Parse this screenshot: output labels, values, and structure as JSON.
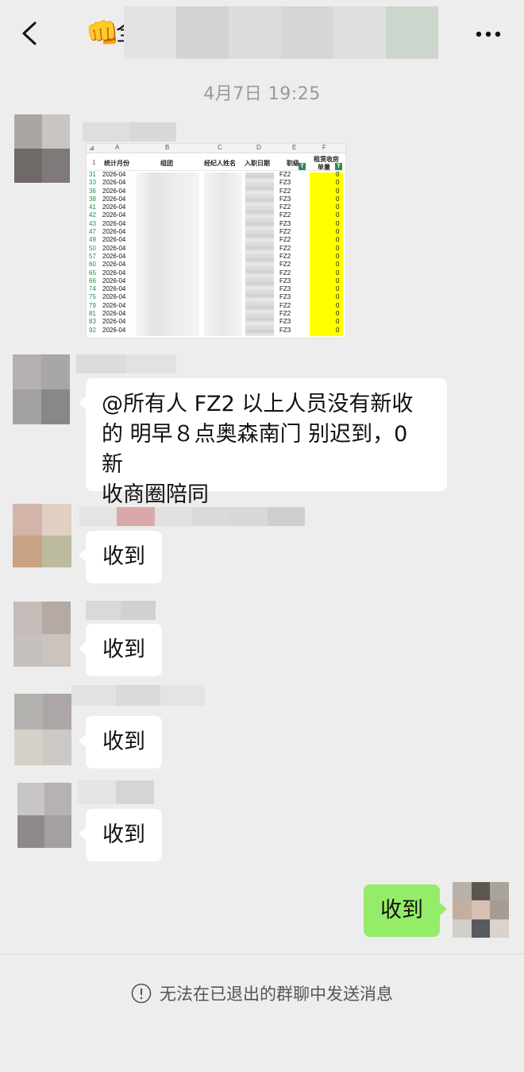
{
  "header": {
    "title_emoji": "👊",
    "title_char": "全"
  },
  "timestamp": "4月7日 19:25",
  "sheet": {
    "col_letters": [
      "A",
      "B",
      "C",
      "D",
      "E",
      "F"
    ],
    "headers": {
      "month": "统计月份",
      "group": "组团",
      "agent": "经纪人姓名",
      "join_date": "入职日期",
      "level": "职级",
      "rent_line1": "租赁收房",
      "rent_line2": "单量",
      "badge": "T"
    },
    "header_row_num": "1",
    "rows": [
      {
        "n": "31",
        "month": "2026-04",
        "level": "FZ2",
        "value": "0"
      },
      {
        "n": "33",
        "month": "2026-04",
        "level": "FZ3",
        "value": "0"
      },
      {
        "n": "36",
        "month": "2026-04",
        "level": "FZ2",
        "value": "0"
      },
      {
        "n": "38",
        "month": "2026-04",
        "level": "FZ3",
        "value": "0"
      },
      {
        "n": "41",
        "month": "2026-04",
        "level": "FZ2",
        "value": "0"
      },
      {
        "n": "42",
        "month": "2026-04",
        "level": "FZ2",
        "value": "0"
      },
      {
        "n": "43",
        "month": "2026-04",
        "level": "FZ3",
        "value": "0"
      },
      {
        "n": "47",
        "month": "2026-04",
        "level": "FZ2",
        "value": "0"
      },
      {
        "n": "49",
        "month": "2026-04",
        "level": "FZ2",
        "value": "0"
      },
      {
        "n": "50",
        "month": "2026-04",
        "level": "FZ2",
        "value": "0"
      },
      {
        "n": "57",
        "month": "2026-04",
        "level": "FZ2",
        "value": "0"
      },
      {
        "n": "60",
        "month": "2026-04",
        "level": "FZ2",
        "value": "0"
      },
      {
        "n": "65",
        "month": "2026-04",
        "level": "FZ2",
        "value": "0"
      },
      {
        "n": "66",
        "month": "2026-04",
        "level": "FZ3",
        "value": "0"
      },
      {
        "n": "74",
        "month": "2026-04",
        "level": "FZ3",
        "value": "0"
      },
      {
        "n": "75",
        "month": "2026-04",
        "level": "FZ3",
        "value": "0"
      },
      {
        "n": "79",
        "month": "2026-04",
        "level": "FZ2",
        "value": "0"
      },
      {
        "n": "81",
        "month": "2026-04",
        "level": "FZ2",
        "value": "0"
      },
      {
        "n": "83",
        "month": "2026-04",
        "level": "FZ3",
        "value": "0"
      },
      {
        "n": "92",
        "month": "2026-04",
        "level": "FZ3",
        "value": "0"
      }
    ]
  },
  "messages": {
    "announcement": {
      "line1": "@所有人 FZ2 以上人员没有新收",
      "line2": "的 明早８点奥森南门 别迟到，0 新",
      "line3": "收商圈陪同"
    },
    "reply1": "收到",
    "reply2": "收到",
    "reply3": "收到",
    "reply4": "收到",
    "my_reply": "收到"
  },
  "footer": {
    "notice": "无法在已退出的群聊中发送消息"
  }
}
